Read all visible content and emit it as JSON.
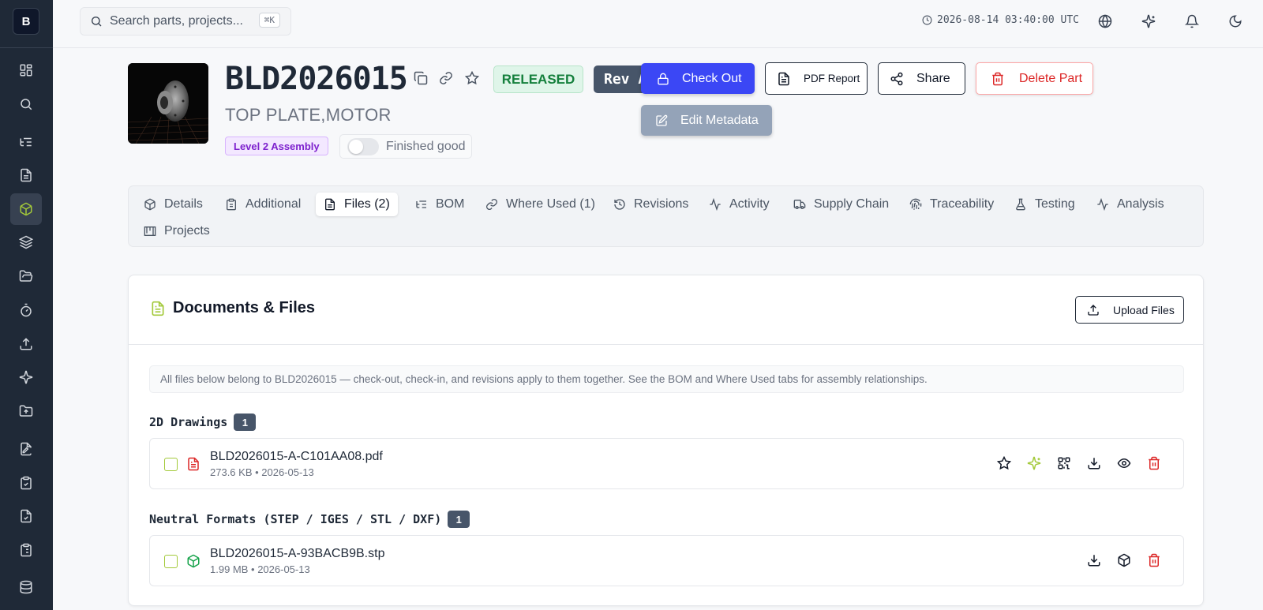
{
  "brand": {
    "logo_letter": "B"
  },
  "sidebar": {
    "items": [
      {
        "name": "dashboard-icon"
      },
      {
        "name": "search-icon"
      },
      {
        "name": "list-tree-icon"
      },
      {
        "name": "document-icon"
      },
      {
        "name": "cube-icon",
        "active": true
      },
      {
        "name": "layers-icon"
      },
      {
        "name": "folder-open-icon"
      },
      {
        "name": "timer-icon"
      },
      {
        "name": "upload-icon"
      },
      {
        "name": "sparkles-icon"
      },
      {
        "name": "folder-upload-icon"
      },
      {
        "name": "file-signature-icon"
      },
      {
        "name": "clipboard-check-icon"
      },
      {
        "name": "file-check-icon"
      },
      {
        "name": "clipboard-list-icon"
      },
      {
        "name": "database-icon"
      }
    ]
  },
  "topbar": {
    "search_placeholder": "Search parts, projects...",
    "shortcut": "⌘K",
    "timestamp": "2026-08-14 03:40:00 UTC"
  },
  "part": {
    "number": "BLD2026015",
    "description": "TOP PLATE,MOTOR",
    "status": "RELEASED",
    "revision": "Rev A",
    "level": "Level 2 Assembly",
    "finished_good_label": "Finished good",
    "finished_good": false
  },
  "actions": {
    "check_out": "Check Out",
    "edit_metadata": "Edit Metadata",
    "pdf_report": "PDF Report",
    "share": "Share",
    "delete": "Delete Part"
  },
  "tabs": [
    {
      "label": "Details",
      "icon": "cube-icon"
    },
    {
      "label": "Additional",
      "icon": "clipboard-icon"
    },
    {
      "label": "Files (2)",
      "icon": "file-icon",
      "active": true
    },
    {
      "label": "BOM",
      "icon": "list-tree-icon"
    },
    {
      "label": "Where Used (1)",
      "icon": "link-icon"
    },
    {
      "label": "Revisions",
      "icon": "history-icon"
    },
    {
      "label": "Activity",
      "icon": "activity-icon"
    },
    {
      "label": "Supply Chain",
      "icon": "truck-icon"
    },
    {
      "label": "Traceability",
      "icon": "fingerprint-icon"
    },
    {
      "label": "Testing",
      "icon": "flask-icon"
    },
    {
      "label": "Analysis",
      "icon": "activity-icon"
    },
    {
      "label": "Projects",
      "icon": "kanban-icon"
    }
  ],
  "files_panel": {
    "title": "Documents & Files",
    "upload_label": "Upload Files",
    "note": "All files below belong to BLD2026015 — check-out, check-in, and revisions apply to them together. See the BOM and Where Used tabs for assembly relationships.",
    "sections": [
      {
        "title": "2D Drawings",
        "count": "1",
        "files": [
          {
            "name": "BLD2026015-A-C101AA08.pdf",
            "meta": "273.6 KB • 2026-05-13",
            "type_icon": "pdf-file-icon"
          }
        ]
      },
      {
        "title": "Neutral Formats (STEP / IGES / STL / DXF)",
        "count": "1",
        "files": [
          {
            "name": "BLD2026015-A-93BACB9B.stp",
            "meta": "1.99 MB • 2026-05-13",
            "type_icon": "cube-icon"
          }
        ]
      }
    ]
  },
  "colors": {
    "accent": "#a3c93a",
    "primary": "#3b47f5",
    "danger": "#dc2626",
    "released": "#15803d"
  }
}
